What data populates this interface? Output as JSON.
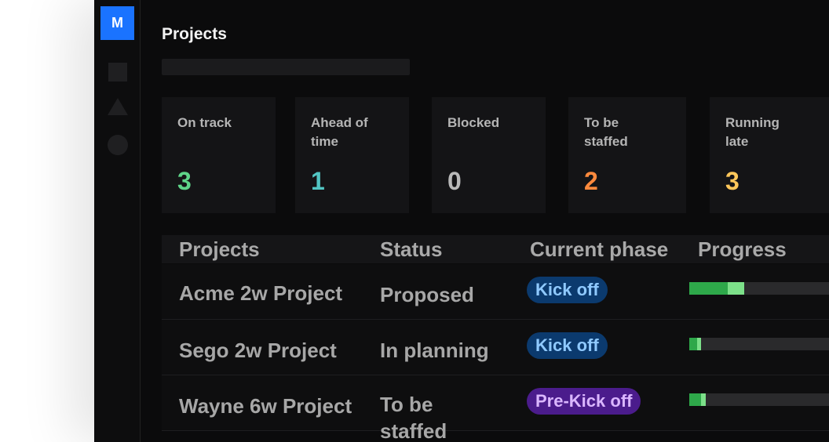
{
  "app": {
    "logo_text": "M",
    "page_title": "Projects",
    "rail_icons": [
      "square-icon",
      "triangle-icon",
      "circle-icon"
    ]
  },
  "summary_cards": [
    {
      "label": "On track",
      "value": "3",
      "color": "#5ed488"
    },
    {
      "label": "Ahead of time",
      "value": "1",
      "color": "#52c5c3"
    },
    {
      "label": "Blocked",
      "value": "0",
      "color": "#b9b9b9"
    },
    {
      "label": "To be staffed",
      "value": "2",
      "color": "#ff8a3d"
    },
    {
      "label": "Running late",
      "value": "3",
      "color": "#ffc75a"
    }
  ],
  "table": {
    "headers": [
      "Projects",
      "Status",
      "Current phase",
      "Progress"
    ],
    "rows": [
      {
        "project": "Acme 2w Project",
        "status": "Proposed",
        "phase": "Kick off",
        "phase_color": "blue",
        "progress_dark": 0.26,
        "progress_light": 0.11
      },
      {
        "project": "Sego 2w Project",
        "status": "In planning",
        "phase": "Kick off",
        "phase_color": "blue",
        "progress_dark": 0.05,
        "progress_light": 0.03
      },
      {
        "project": "Wayne 6w Project",
        "status": "To be staffed",
        "phase": "Pre-Kick off",
        "phase_color": "purple",
        "progress_dark": 0.08,
        "progress_light": 0.03
      }
    ]
  },
  "colors": {
    "accent": "#1a73ff",
    "background": "#0b0b0c",
    "progress_dark": "#2ea84a",
    "progress_light": "#7ce089"
  }
}
